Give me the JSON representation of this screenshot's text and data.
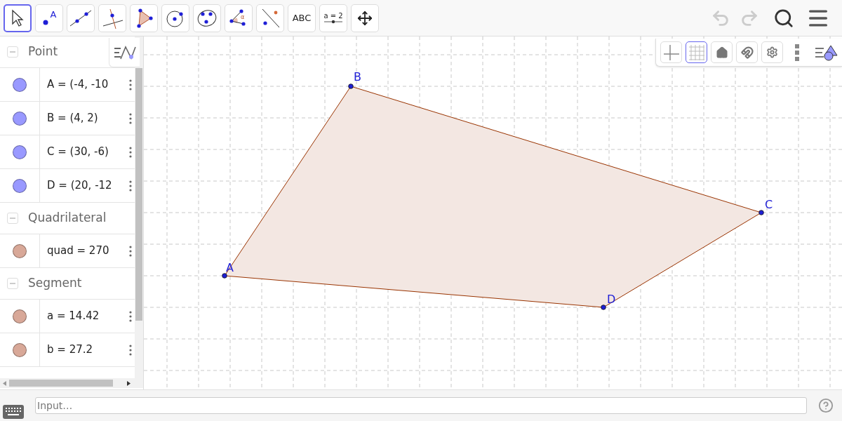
{
  "toolbar": {
    "tools": [
      {
        "kind": "move",
        "selected": true
      },
      {
        "kind": "point",
        "selected": false,
        "label": "A"
      },
      {
        "kind": "line",
        "selected": false
      },
      {
        "kind": "perpendicular",
        "selected": false
      },
      {
        "kind": "polygon",
        "selected": false
      },
      {
        "kind": "circle",
        "selected": false
      },
      {
        "kind": "conic",
        "selected": false
      },
      {
        "kind": "angle",
        "selected": false,
        "label": "α"
      },
      {
        "kind": "reflect",
        "selected": false
      },
      {
        "kind": "text",
        "selected": false,
        "label": "ABC"
      },
      {
        "kind": "slider",
        "selected": false,
        "label": "a = 2"
      },
      {
        "kind": "pan",
        "selected": false
      }
    ],
    "history": [
      {
        "kind": "undo",
        "disabled": true
      },
      {
        "kind": "redo",
        "disabled": true
      }
    ]
  },
  "algebra": {
    "groups": [
      {
        "title": "Point",
        "expanded": true,
        "items": [
          {
            "text": "A = (-4, -10",
            "color": "#9999ff"
          },
          {
            "text": "B = (4, 2)",
            "color": "#9999ff"
          },
          {
            "text": "C = (30, -6)",
            "color": "#9999ff"
          },
          {
            "text": "D = (20, -12",
            "color": "#9999ff"
          }
        ]
      },
      {
        "title": "Quadrilateral",
        "expanded": true,
        "items": [
          {
            "text": "quad = 270",
            "color": "#d8a898"
          }
        ]
      },
      {
        "title": "Segment",
        "expanded": true,
        "items": [
          {
            "text": "a = 14.42",
            "color": "#d8a898"
          },
          {
            "text": "b = 27.2",
            "color": "#d8a898"
          }
        ]
      }
    ]
  },
  "graphics": {
    "style_bar": [
      {
        "kind": "axes",
        "selected": false
      },
      {
        "kind": "grid",
        "selected": true
      },
      {
        "kind": "home",
        "selected": false
      },
      {
        "kind": "snap",
        "selected": false
      },
      {
        "kind": "settings",
        "selected": false
      }
    ],
    "points": [
      {
        "label": "A"
      },
      {
        "label": "B"
      },
      {
        "label": "C"
      },
      {
        "label": "D"
      }
    ]
  },
  "input_bar": {
    "placeholder": "Input…"
  }
}
